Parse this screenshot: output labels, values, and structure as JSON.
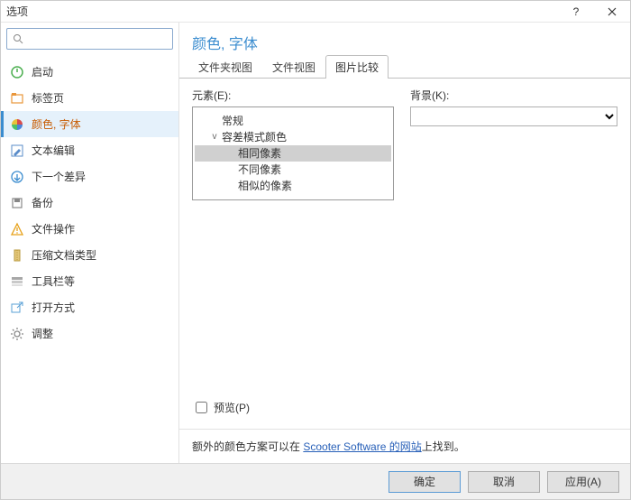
{
  "titlebar": {
    "title": "选项"
  },
  "search": {
    "placeholder": ""
  },
  "sidebar": {
    "items": [
      {
        "key": "startup",
        "label": "启动"
      },
      {
        "key": "tabs",
        "label": "标签页"
      },
      {
        "key": "colors",
        "label": "颜色, 字体"
      },
      {
        "key": "textedit",
        "label": "文本编辑"
      },
      {
        "key": "nextdiff",
        "label": "下一个差异"
      },
      {
        "key": "backup",
        "label": "备份"
      },
      {
        "key": "fileop",
        "label": "文件操作"
      },
      {
        "key": "archive",
        "label": "压缩文档类型"
      },
      {
        "key": "toolbars",
        "label": "工具栏等"
      },
      {
        "key": "openwith",
        "label": "打开方式"
      },
      {
        "key": "tweaks",
        "label": "调整"
      }
    ],
    "active_index": 2
  },
  "panel": {
    "title": "颜色, 字体",
    "tabs": [
      "文件夹视图",
      "文件视图",
      "图片比较"
    ],
    "active_tab": 2,
    "element_label": "元素(E):",
    "background_label": "背景(K):",
    "tree": [
      {
        "depth": 0,
        "label": "常规",
        "expander": ""
      },
      {
        "depth": 0,
        "label": "容差模式颜色",
        "expander": "v"
      },
      {
        "depth": 1,
        "label": "相同像素",
        "selected": true
      },
      {
        "depth": 1,
        "label": "不同像素"
      },
      {
        "depth": 1,
        "label": "相似的像素"
      }
    ],
    "preview_label": "预览(P)"
  },
  "footer": {
    "prefix": "额外的颜色方案可以在 ",
    "link": "Scooter Software 的网站",
    "suffix": "上找到。"
  },
  "buttons": {
    "ok": "确定",
    "cancel": "取消",
    "apply": "应用(A)"
  }
}
